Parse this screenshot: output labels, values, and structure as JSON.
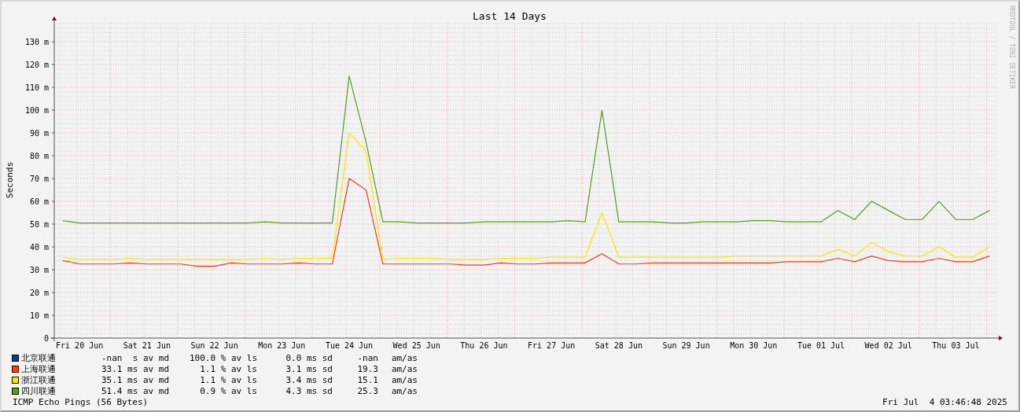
{
  "graph": {
    "credit": "RRDTOOL / TOBI OETIKER",
    "chart_data": {
      "type": "line",
      "title": "Last 14 Days",
      "ylabel": "Seconds",
      "grid": true,
      "categories": [
        null,
        "Fri 20 Jun",
        null,
        null,
        null,
        "Sat 21 Jun",
        null,
        null,
        null,
        "Sun 22 Jun",
        null,
        null,
        null,
        "Mon 23 Jun",
        null,
        null,
        null,
        "Tue 24 Jun",
        null,
        null,
        null,
        "Wed 25 Jun",
        null,
        null,
        null,
        "Thu 26 Jun",
        null,
        null,
        null,
        "Fri 27 Jun",
        null,
        null,
        null,
        "Sat 28 Jun",
        null,
        null,
        null,
        "Sun 29 Jun",
        null,
        null,
        null,
        "Mon 30 Jun",
        null,
        null,
        null,
        "Tue 01 Jul",
        null,
        null,
        null,
        "Wed 02 Jul",
        null,
        null,
        null,
        "Thu 03 Jul",
        null,
        null
      ],
      "ylim": [
        0,
        138.3
      ],
      "yticks": [
        {
          "value": 0,
          "label": "0"
        },
        {
          "value": 10,
          "label": "10 m"
        },
        {
          "value": 20,
          "label": "20 m"
        },
        {
          "value": 30,
          "label": "30 m"
        },
        {
          "value": 40,
          "label": "40 m"
        },
        {
          "value": 50,
          "label": "50 m"
        },
        {
          "value": 60,
          "label": "60 m"
        },
        {
          "value": 70,
          "label": "70 m"
        },
        {
          "value": 80,
          "label": "80 m"
        },
        {
          "value": 90,
          "label": "90 m"
        },
        {
          "value": 100,
          "label": "100 m"
        },
        {
          "value": 110,
          "label": "110 m"
        },
        {
          "value": 120,
          "label": "120 m"
        },
        {
          "value": 130,
          "label": "130 m"
        }
      ],
      "series": [
        {
          "name": "上海联通",
          "color": "#ff3b12",
          "values": [
            34,
            32.5,
            32.5,
            32.5,
            33,
            32.5,
            32.5,
            32.5,
            31.5,
            31.5,
            33,
            32.5,
            32.5,
            32.5,
            33,
            32.5,
            32.5,
            70,
            65,
            32.5,
            32.5,
            32.5,
            32.5,
            32.5,
            32,
            32,
            33,
            32.5,
            32.5,
            33,
            33,
            33,
            37,
            32.5,
            32.5,
            33,
            33,
            33,
            33,
            33,
            33,
            33,
            33,
            33.5,
            33.5,
            33.5,
            35,
            33.5,
            36,
            34,
            33.5,
            33.5,
            35,
            33.5,
            33.5,
            36
          ]
        },
        {
          "name": "浙江联通",
          "color": "#ffe400",
          "values": [
            35.5,
            34.5,
            34.5,
            34.5,
            35,
            34.5,
            34.5,
            34.5,
            34.5,
            34.5,
            34.5,
            34.5,
            35,
            34.5,
            35,
            35,
            35,
            90,
            82,
            34.5,
            35,
            35,
            35,
            34.5,
            34.5,
            34.5,
            35,
            35,
            35,
            35.5,
            35.5,
            35.5,
            55,
            35.5,
            35.5,
            35.5,
            35.5,
            35.5,
            35.5,
            35.5,
            36,
            36,
            36,
            36,
            36,
            36,
            39,
            36,
            42,
            38,
            36,
            36,
            40,
            35.5,
            35.5,
            40
          ]
        },
        {
          "name": "四川联通",
          "color": "#52a01c",
          "values": [
            51.5,
            50.5,
            50.5,
            50.5,
            50.5,
            50.5,
            50.5,
            50.5,
            50.5,
            50.5,
            50.5,
            50.5,
            51,
            50.5,
            50.5,
            50.5,
            50.5,
            115,
            86,
            51,
            51,
            50.5,
            50.5,
            50.5,
            50.5,
            51,
            51,
            51,
            51,
            51,
            51.5,
            51,
            100,
            51,
            51,
            51,
            50.5,
            50.5,
            51,
            51,
            51,
            51.5,
            51.5,
            51,
            51,
            51,
            56,
            52,
            60,
            56,
            52,
            52,
            60,
            52,
            52,
            56
          ]
        }
      ]
    }
  },
  "legend": [
    {
      "name": "北京联通",
      "color": "#0b3f8f",
      "median": "-nan  s av md",
      "loss": "100.0 % av ls",
      "sd": "0.0 ms sd",
      "am": "-nan",
      "unit": "am/as"
    },
    {
      "median": "33.1 ms av md",
      "loss": "1.1 % av ls",
      "sd": "3.1 ms sd",
      "am": "19.3",
      "unit": "am/as"
    },
    {
      "median": "35.1 ms av md",
      "loss": "1.1 % av ls",
      "sd": "3.4 ms sd",
      "am": "15.1",
      "unit": "am/as"
    },
    {
      "median": "51.4 ms av md",
      "loss": "0.9 % av ls",
      "sd": "4.3 ms sd",
      "am": "25.3",
      "unit": "am/as"
    }
  ],
  "footer": {
    "caption": "ICMP Echo Pings (56 Bytes)",
    "timestamp": "Fri Jul  4 03:46:48 2025"
  }
}
